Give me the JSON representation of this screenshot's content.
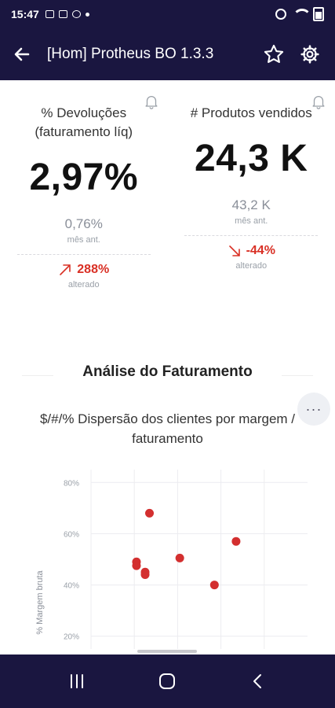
{
  "status_bar": {
    "time": "15:47"
  },
  "app_bar": {
    "title": "[Hom] Protheus BO 1.3.3"
  },
  "kpis": [
    {
      "label": "% Devoluções (faturamento líq)",
      "value": "2,97%",
      "previous": "0,76%",
      "previous_label": "mês ant.",
      "change": "288%",
      "change_direction": "up",
      "change_label": "alterado"
    },
    {
      "label": "# Produtos vendidos",
      "value": "24,3 K",
      "previous": "43,2 K",
      "previous_label": "mês ant.",
      "change": "-44%",
      "change_direction": "down",
      "change_label": "alterado"
    }
  ],
  "section": {
    "title": "Análise do Faturamento",
    "more_label": "···"
  },
  "chart_title": "$/#/% Dispersão dos clientes por margem / faturamento",
  "chart_data": {
    "type": "scatter",
    "title": "$/#/% Dispersão dos clientes por margem / faturamento",
    "ylabel": "% Margem bruta",
    "xlabel": "",
    "ylim": [
      15,
      85
    ],
    "xlim": [
      0,
      5
    ],
    "yticks": [
      "80%",
      "60%",
      "40%",
      "20%"
    ],
    "ytick_values": [
      80,
      60,
      40,
      20
    ],
    "xgrid": [
      1,
      2,
      3,
      4
    ],
    "grid": true,
    "points": [
      {
        "x": 1.35,
        "y": 68
      },
      {
        "x": 1.05,
        "y": 49
      },
      {
        "x": 1.05,
        "y": 47.5
      },
      {
        "x": 1.25,
        "y": 45
      },
      {
        "x": 1.25,
        "y": 44
      },
      {
        "x": 2.05,
        "y": 50.5
      },
      {
        "x": 2.85,
        "y": 40
      },
      {
        "x": 3.35,
        "y": 57
      }
    ],
    "point_color": "#d32f2f"
  },
  "colors": {
    "header": "#1a1640",
    "negative": "#d93025",
    "muted": "#8a8f99"
  }
}
